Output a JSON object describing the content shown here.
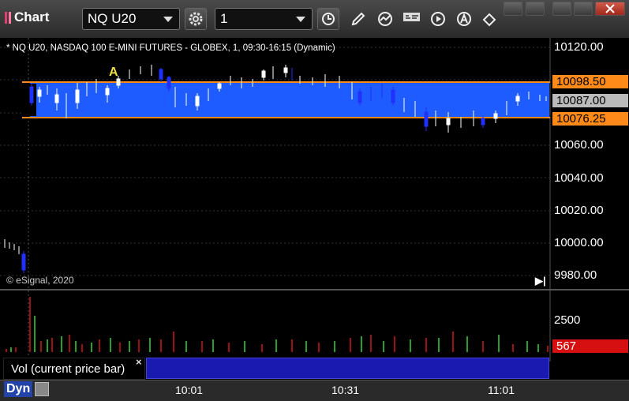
{
  "toolbar": {
    "title": "Chart",
    "symbol": "NQ U20",
    "interval": "1",
    "colors": {
      "accent": "#e04070"
    }
  },
  "chart": {
    "header": "* NQ U20, NASDAQ 100 E-MINI FUTURES - GLOBEX, 1, 09:30-16:15 (Dynamic)",
    "marker_label": "A",
    "copyright": "© eSignal, 2020",
    "price_labels": [
      "10120.00",
      "10060.00",
      "10040.00",
      "10020.00",
      "10000.00",
      "9980.00"
    ],
    "upper_line": "10098.50",
    "last_price": "10087.00",
    "lower_line": "10076.25",
    "box_color": "#1e5cff",
    "line_color": "#ff8a1a"
  },
  "volume": {
    "label": "Vol (current price bar)",
    "scale_label": "2500",
    "current_value": "567"
  },
  "bottom": {
    "mode": "Dyn",
    "time_labels": [
      "10:01",
      "10:31",
      "11:01"
    ]
  }
}
